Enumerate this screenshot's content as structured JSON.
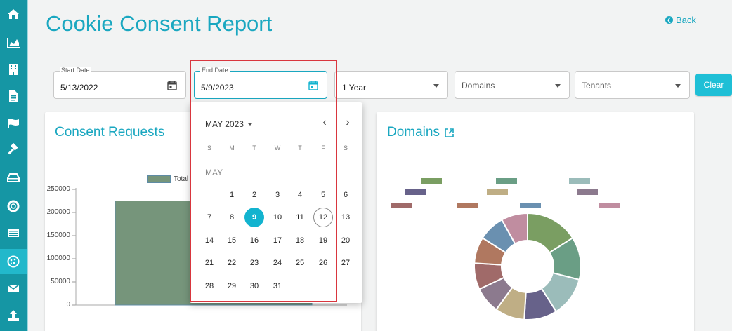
{
  "page": {
    "title": "Cookie Consent Report",
    "back_label": "Back"
  },
  "sidebar": {
    "items": [
      {
        "icon": "home-icon"
      },
      {
        "icon": "area-chart-icon"
      },
      {
        "icon": "building-icon"
      },
      {
        "icon": "document-icon"
      },
      {
        "icon": "flag-icon"
      },
      {
        "icon": "gavel-icon"
      },
      {
        "icon": "inbox-drive-icon"
      },
      {
        "icon": "life-ring-icon"
      },
      {
        "icon": "list-card-icon"
      },
      {
        "icon": "cookie-icon",
        "active": true
      },
      {
        "icon": "envelope-icon"
      },
      {
        "icon": "upload-icon"
      }
    ]
  },
  "filters": {
    "start_date": {
      "label": "Start Date",
      "value": "5/13/2022"
    },
    "end_date": {
      "label": "End Date",
      "value": "5/9/2023"
    },
    "period": {
      "value": "1 Year"
    },
    "domains": {
      "placeholder": "Domains"
    },
    "tenants": {
      "placeholder": "Tenants"
    },
    "clear_label": "Clear"
  },
  "consent_card": {
    "title": "Consent Requests",
    "legend_label": "Total C"
  },
  "domains_card": {
    "title": "Domains"
  },
  "datepicker": {
    "month_label": "MAY 2023",
    "month_section": "MAY",
    "weekdays": [
      "S",
      "M",
      "T",
      "W",
      "T",
      "F",
      "S"
    ],
    "selected_day": 9,
    "today_day": 12,
    "first_weekday": 1,
    "days_in_month": 31
  },
  "colors": {
    "accent": "#1aa7c0",
    "sidebar": "#1596a4",
    "selected": "#12b3cf",
    "highlight": "#d9363e"
  },
  "chart_data": [
    {
      "type": "bar",
      "title": "Consent Requests",
      "categories": [
        ""
      ],
      "series": [
        {
          "name": "Total C",
          "values": [
            225000
          ]
        }
      ],
      "yticks": [
        "250000",
        "200000",
        "150000",
        "100000",
        "50000",
        "0"
      ],
      "ylim": [
        0,
        250000
      ],
      "color": "#76957b"
    },
    {
      "type": "pie",
      "title": "Domains",
      "slices": [
        {
          "label": "",
          "value": 16,
          "color": "#7a9e62"
        },
        {
          "label": "",
          "value": 13,
          "color": "#6a9e85"
        },
        {
          "label": "",
          "value": 12,
          "color": "#9bbcba"
        },
        {
          "label": "",
          "value": 10,
          "color": "#67628a"
        },
        {
          "label": "",
          "value": 9,
          "color": "#bfae85"
        },
        {
          "label": "",
          "value": 8,
          "color": "#8c7a8e"
        },
        {
          "label": "",
          "value": 8,
          "color": "#a06a69"
        },
        {
          "label": "",
          "value": 8,
          "color": "#b07860"
        },
        {
          "label": "",
          "value": 8,
          "color": "#6a90b0"
        },
        {
          "label": "",
          "value": 8,
          "color": "#c08da0"
        }
      ]
    }
  ]
}
